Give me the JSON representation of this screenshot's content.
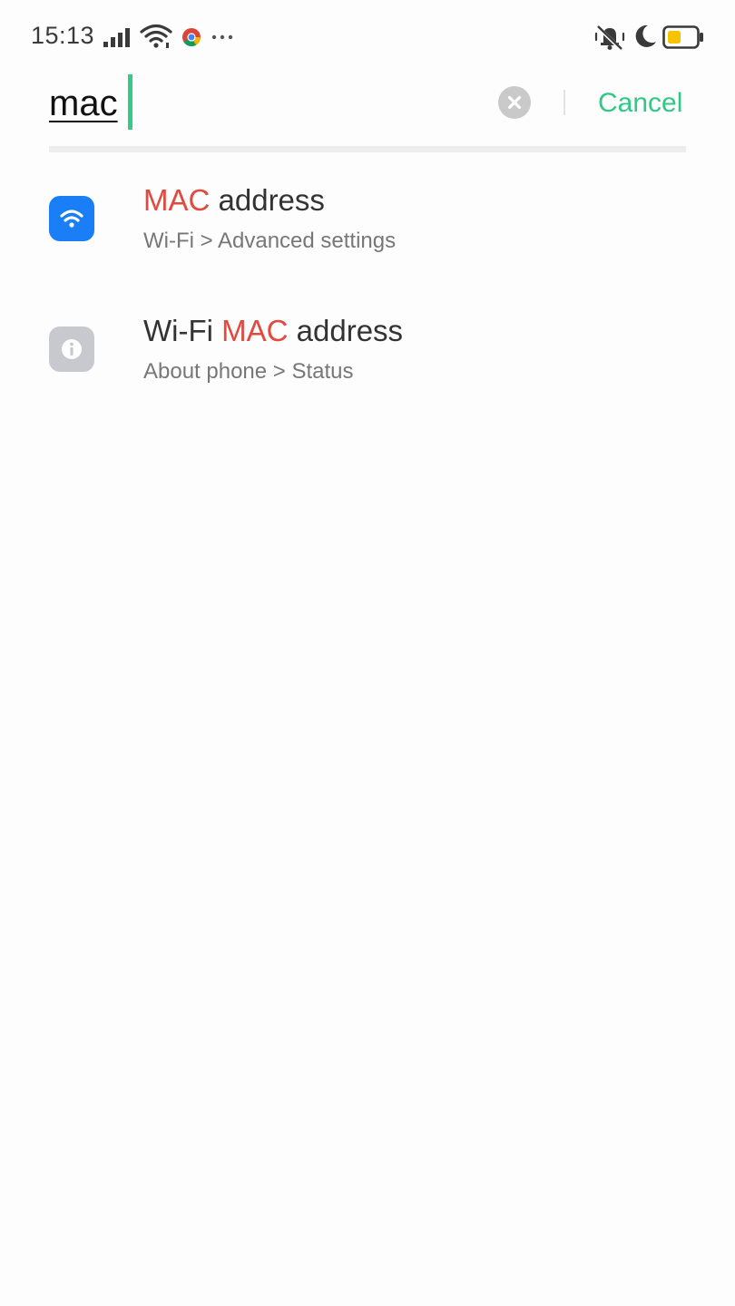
{
  "status_bar": {
    "time": "15:13",
    "left_icons": [
      "signal-icon",
      "wifi-icon",
      "chrome-icon",
      "more-dots-icon"
    ],
    "right_icons": [
      "vibrate-off-icon",
      "moon-icon",
      "battery-icon"
    ],
    "battery_color": "#f5c400"
  },
  "search": {
    "query": "mac",
    "cancel_label": "Cancel",
    "accent_color": "#2fc986"
  },
  "results": [
    {
      "icon": "wifi-icon",
      "icon_color": "#1a7ef6",
      "title_prefix": "",
      "title_highlight": "MAC",
      "title_suffix": " address",
      "path": "Wi-Fi > Advanced settings"
    },
    {
      "icon": "info-icon",
      "icon_color": "#c7c9cf",
      "title_prefix": "Wi-Fi ",
      "title_highlight": "MAC",
      "title_suffix": " address",
      "path": "About phone > Status"
    }
  ],
  "highlight_color": "#e2493f"
}
